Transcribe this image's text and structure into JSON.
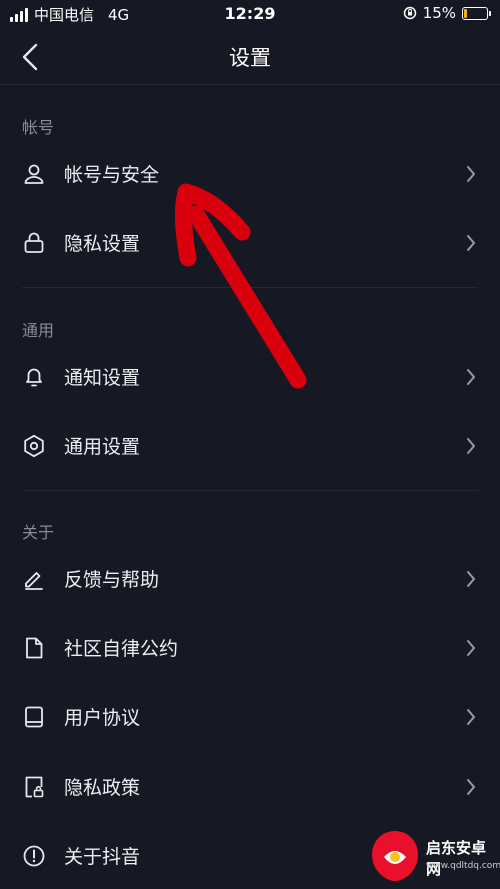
{
  "status_bar": {
    "carrier": "中国电信",
    "network": "4G",
    "time": "12:29",
    "battery_percent": "15%",
    "battery_level": 0.15,
    "battery_color": "#f4b400"
  },
  "nav": {
    "title": "设置",
    "back_icon": "chevron-left-icon"
  },
  "sections": [
    {
      "title": "帐号",
      "items": [
        {
          "label": "帐号与安全",
          "icon": "user-icon"
        },
        {
          "label": "隐私设置",
          "icon": "lock-icon"
        }
      ]
    },
    {
      "title": "通用",
      "items": [
        {
          "label": "通知设置",
          "icon": "bell-icon"
        },
        {
          "label": "通用设置",
          "icon": "gear-icon"
        }
      ]
    },
    {
      "title": "关于",
      "items": [
        {
          "label": "反馈与帮助",
          "icon": "pencil-icon"
        },
        {
          "label": "社区自律公约",
          "icon": "document-icon"
        },
        {
          "label": "用户协议",
          "icon": "book-icon"
        },
        {
          "label": "隐私政策",
          "icon": "locked-document-icon"
        },
        {
          "label": "关于抖音",
          "icon": "info-icon"
        }
      ]
    }
  ],
  "annotation": {
    "color": "#d9000d"
  },
  "watermark": {
    "name": "启东安卓网",
    "url": "www.qdltdq.com"
  },
  "colors": {
    "background": "#161823",
    "text": "#eeeef2",
    "section_title": "#8a8b94",
    "divider": "#262833"
  }
}
